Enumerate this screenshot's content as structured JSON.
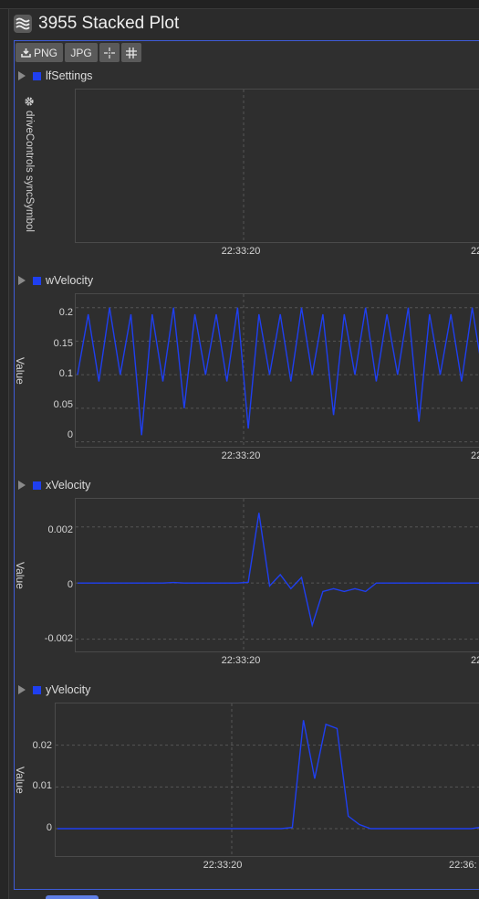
{
  "window": {
    "title": "3955 Stacked Plot",
    "icon": "stacked-plot-icon"
  },
  "toolbar": {
    "png_label": "PNG",
    "jpg_label": "JPG",
    "png_icon": "download-icon",
    "crosshair_icon": "crosshair-icon",
    "grid_icon": "grid-icon"
  },
  "side_label": {
    "icon": "gear-icon",
    "text": "driveControls syncSymbol"
  },
  "colors": {
    "series": "#1f3ff0",
    "accent": "#3e5bd6",
    "grid": "#555555",
    "background": "#2e2e2e"
  },
  "chart_data": [
    {
      "type": "line",
      "title": "lfSettings",
      "ylabel": "",
      "x_ticks": [
        "22:33:20",
        "22:3"
      ],
      "y_ticks": [],
      "series": []
    },
    {
      "type": "line",
      "title": "wVelocity",
      "ylabel": "Value",
      "x_ticks": [
        "22:33:20",
        "22:3"
      ],
      "y_ticks": [
        "0.2",
        "0.15",
        "0.1",
        "0.05",
        "0"
      ],
      "ylim": [
        -0.01,
        0.22
      ],
      "series": [
        {
          "name": "wVelocity",
          "values": [
            0.1,
            0.19,
            0.09,
            0.2,
            0.1,
            0.19,
            0.01,
            0.19,
            0.09,
            0.2,
            0.05,
            0.19,
            0.1,
            0.19,
            0.09,
            0.2,
            0.02,
            0.19,
            0.1,
            0.19,
            0.09,
            0.2,
            0.1,
            0.19,
            0.04,
            0.19,
            0.1,
            0.2,
            0.09,
            0.19,
            0.1,
            0.2,
            0.03,
            0.19,
            0.1,
            0.19,
            0.09,
            0.2,
            0.1,
            0.19
          ]
        }
      ]
    },
    {
      "type": "line",
      "title": "xVelocity",
      "ylabel": "Value",
      "x_ticks": [
        "22:33:20",
        "22:3"
      ],
      "y_ticks": [
        "0.002",
        "0",
        "-0.002"
      ],
      "ylim": [
        -0.0025,
        0.003
      ],
      "series": [
        {
          "name": "xVelocity",
          "values": [
            0,
            0,
            0,
            0,
            0,
            0,
            0,
            0,
            0,
            2e-05,
            0,
            0,
            0,
            0,
            0,
            0,
            3e-05,
            0.0025,
            -0.0001,
            0.0003,
            -0.0002,
            0.0002,
            -0.0015,
            -0.0003,
            -0.0002,
            -0.0003,
            -0.0002,
            -0.0003,
            0,
            0,
            0,
            0,
            0,
            0,
            0,
            0,
            0,
            0,
            0,
            0.0001
          ]
        }
      ]
    },
    {
      "type": "line",
      "title": "yVelocity",
      "ylabel": "Value",
      "x_ticks": [
        "22:33:20",
        "22:36:"
      ],
      "y_ticks": [
        "0.02",
        "0.01",
        "0"
      ],
      "ylim": [
        -0.007,
        0.03
      ],
      "series": [
        {
          "name": "yVelocity",
          "values": [
            0,
            0,
            0,
            0,
            0,
            0,
            0,
            0,
            0,
            0,
            0,
            0,
            0,
            0,
            0,
            0,
            0,
            0,
            0,
            0,
            0,
            0.0003,
            0.026,
            0.012,
            0.025,
            0.024,
            0.003,
            0.001,
            0,
            0,
            0,
            0,
            0,
            0,
            0,
            0,
            0,
            0,
            0.0004,
            0
          ]
        }
      ]
    }
  ]
}
